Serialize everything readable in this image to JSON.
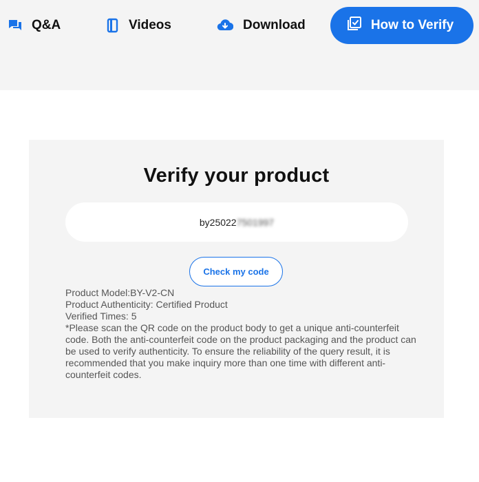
{
  "nav": {
    "items": [
      {
        "label": "Q&A",
        "icon": "chat-icon"
      },
      {
        "label": "Videos",
        "icon": "book-icon"
      },
      {
        "label": "Download",
        "icon": "cloud-download-icon"
      }
    ],
    "verify": {
      "label": "How to Verify",
      "icon": "checklist-icon"
    }
  },
  "verify_panel": {
    "title": "Verify your product",
    "code_visible": "by25022",
    "code_obscured": "7501997",
    "check_button": "Check my code",
    "result": {
      "model": "Product Model:BY-V2-CN",
      "authenticity": "Product Authenticity: Certified Product",
      "verified_times": "Verified Times: 5",
      "note": "*Please scan the QR code on the product body to get a unique anti-counterfeit code. Both the anti-counterfeit code on the product packaging and the product can be used to verify authenticity. To ensure the reliability of the query result, it is recommended that you make inquiry more than one time with different anti-counterfeit codes."
    }
  },
  "colors": {
    "accent": "#1a73e8",
    "header_bg": "#f4f4f4",
    "panel_bg": "#f4f4f4",
    "text_dark": "#111111",
    "text_muted": "#555555"
  }
}
